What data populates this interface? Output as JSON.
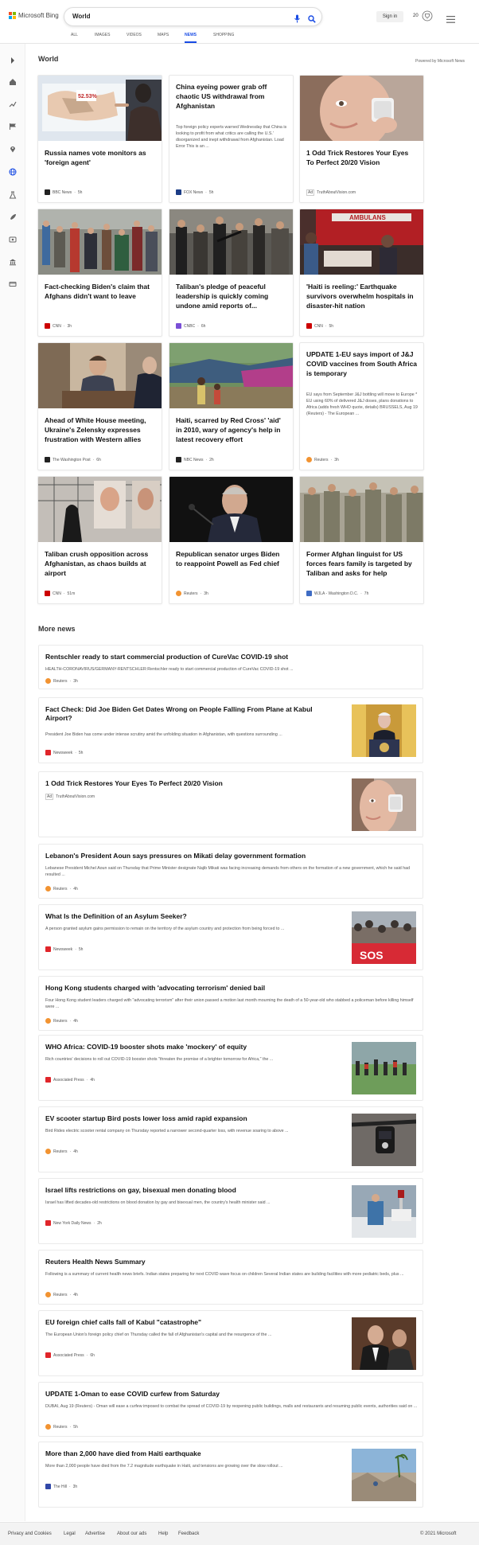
{
  "header": {
    "logo_text": "Microsoft Bing",
    "search_value": "World",
    "signin_label": "Sign in",
    "points": "20",
    "tabs": [
      "ALL",
      "IMAGES",
      "VIDEOS",
      "MAPS",
      "NEWS",
      "SHOPPING"
    ],
    "active_tab": "NEWS",
    "accent_color": "#174ae4"
  },
  "world": {
    "title": "World",
    "powered_by": "Powered by Microsoft News",
    "cards": [
      {
        "title": "Russia names vote monitors as 'foreign agent'",
        "source": "BBC News",
        "time": "5h",
        "source_color": "#222",
        "image": "map-screen-photo"
      },
      {
        "title": "China eyeing power grab off chaotic US withdrawal from Afghanistan",
        "snippet": "Top foreign policy experts warned Wednesday that China is looking to profit from what critics are calling the U.S.' disorganized and inept withdrawal from Afghanistan. Load Error This is an ...",
        "source": "FOX News",
        "time": "5h",
        "source_color": "#1c3d86"
      },
      {
        "title": "1 Odd Trick Restores Your Eyes To Perfect 20/20 Vision",
        "ad": "Ad",
        "source": "TruthAboutVision.com",
        "time": "",
        "image": "eye-ad-photo"
      },
      {
        "title": "Fact-checking Biden's claim that Afghans didn't want to leave",
        "source": "CNN",
        "time": "3h",
        "source_color": "#cc0000",
        "image": "crowd-photo"
      },
      {
        "title": "Taliban's pledge of peaceful leadership is quickly coming undone amid reports of...",
        "source": "CNBC",
        "time": "6h",
        "source_color": "#7a4fd6",
        "image": "taliban-photo"
      },
      {
        "title": "'Haiti is reeling:' Earthquake survivors overwhelm hospitals in disaster-hit nation",
        "source": "CNN",
        "time": "5h",
        "source_color": "#cc0000",
        "image": "ambulance-photo"
      },
      {
        "title": "Ahead of White House meeting, Ukraine's Zelensky expresses frustration with Western allies",
        "source": "The Washington Post",
        "time": "6h",
        "source_color": "#222",
        "image": "zelensky-photo"
      },
      {
        "title": "Haiti, scarred by Red Cross' 'aid' in 2010, wary of agency's help in latest recovery effort",
        "source": "NBC News",
        "time": "2h",
        "source_color": "#222",
        "image": "haiti-camp-photo"
      },
      {
        "title": "UPDATE 1-EU says import of J&J COVID vaccines from South Africa is temporary",
        "snippet": "EU says from September J&J bottling will move to Europe * EU using 60% of delivered J&J doses, plans donations to Africa (adds fresh WHO quote, details) BRUSSELS, Aug 19 (Reuters) - The European ...",
        "source": "Reuters",
        "time": "3h",
        "source_color": "#f29331"
      },
      {
        "title": "Taliban crush opposition across Afghanistan, as chaos builds at airport",
        "source": "CNN",
        "time": "51m",
        "source_color": "#cc0000",
        "image": "wall-poster-photo"
      },
      {
        "title": "Republican senator urges Biden to reappoint Powell as Fed chief",
        "source": "Reuters",
        "time": "3h",
        "source_color": "#f29331",
        "image": "powell-photo"
      },
      {
        "title": "Former Afghan linguist for US forces fears family is targeted by Taliban and asks for help",
        "source": "WJLA - Washington D.C.",
        "time": "7h",
        "source_color": "#3f6cc4",
        "image": "soldiers-photo"
      }
    ]
  },
  "more_news": {
    "title": "More news",
    "items": [
      {
        "title": "Rentschler ready to start commercial production of CureVac COVID-19 shot",
        "snippet": "HEALTH-CORONAVIRUS/GERMANY-RENTSCHLER:Rentschler ready to start commercial production of CureVac COVID-19 shot ...",
        "source": "Reuters",
        "time": "3h",
        "source_color": "#f29331"
      },
      {
        "title": "Fact Check: Did Joe Biden Get Dates Wrong on People Falling From Plane at Kabul Airport?",
        "snippet": "President Joe Biden has come under intense scrutiny amid the unfolding situation in Afghanistan, with questions surrounding ...",
        "source": "Newsweek",
        "time": "5h",
        "source_color": "#e0252a",
        "image": "biden-photo"
      },
      {
        "title": "1 Odd Trick Restores Your Eyes To Perfect 20/20 Vision",
        "ad": "Ad",
        "source": "TruthAboutVision.com",
        "time": "",
        "image": "eye-ad-photo"
      },
      {
        "title": "Lebanon's President Aoun says pressures on Mikati delay government formation",
        "snippet": "Lebanese President Michel Aoun said on Thursday that Prime Minister designate Najib Mikati was facing increasing demands from others on the formation of a new government, which he said had resulted ...",
        "source": "Reuters",
        "time": "4h",
        "source_color": "#f29331"
      },
      {
        "title": "What Is the Definition of an Asylum Seeker?",
        "snippet": "A person granted asylum gains permission to remain on the territory of the asylum country and protection from being forced to ...",
        "source": "Newsweek",
        "time": "5h",
        "source_color": "#e0252a",
        "image": "protest-photo"
      },
      {
        "title": "Hong Kong students charged with 'advocating terrorism' denied bail",
        "snippet": "Four Hong Kong student leaders charged with \"advocating terrorism\" after their union passed a motion last month mourning the death of a 50-year-old who stabbed a policeman before killing himself were ...",
        "source": "Reuters",
        "time": "4h",
        "source_color": "#f29331"
      },
      {
        "title": "WHO Africa: COVID-19 booster shots make 'mockery' of equity",
        "snippet": "Rich countries' decisions to roll out COVID-19 booster shots \"threaten the promise of a brighter tomorrow for Africa,\" the ...",
        "source": "Associated Press",
        "time": "4h",
        "source_color": "#e0252a",
        "image": "who-photo"
      },
      {
        "title": "EV scooter startup Bird posts lower loss amid rapid expansion",
        "snippet": "Bird Rides electric scooter rental company on Thursday reported a narrower second-quarter loss, with revenue soaring to above ...",
        "source": "Reuters",
        "time": "4h",
        "source_color": "#f29331",
        "image": "scooter-photo"
      },
      {
        "title": "Israel lifts restrictions on gay, bisexual men donating blood",
        "snippet": "Israel has lifted decades-old restrictions on blood donation by gay and bisexual men, the country's health minister said ...",
        "source": "New York Daily News",
        "time": "2h",
        "source_color": "#e0252a",
        "image": "blood-photo"
      },
      {
        "title": "Reuters Health News Summary",
        "snippet": "Following is a summary of current health news briefs. Indian states preparing for next COVID wave focus on children Several Indian states are building facilities with more pediatric beds, plus ...",
        "source": "Reuters",
        "time": "4h",
        "source_color": "#f29331"
      },
      {
        "title": "EU foreign chief calls fall of Kabul \"catastrophe\"",
        "snippet": "The European Union's foreign policy chief on Thursday called the fall of Afghanistan's capital and the resurgence of the ...",
        "source": "Associated Press",
        "time": "6h",
        "source_color": "#e0252a",
        "image": "ghani-photo"
      },
      {
        "title": "UPDATE 1-Oman to ease COVID curfew from Saturday",
        "snippet": "DUBAI, Aug 19 (Reuters) - Oman will ease a curfew imposed to combat the spread of COVID-19 by reopening public buildings, malls and restaurants and resuming public events, authorities said on ...",
        "source": "Reuters",
        "time": "5h",
        "source_color": "#f29331"
      },
      {
        "title": "More than 2,000 have died from Haiti earthquake",
        "snippet": "More than 2,000 people have died from the 7.2 magnitude earthquake in Haiti, and tensions are growing over the slow rollout ...",
        "source": "The Hill",
        "time": "3h",
        "source_color": "#3148a8",
        "image": "rubble-photo"
      }
    ]
  },
  "footer": {
    "links": [
      "Privacy and Cookies",
      "Legal",
      "Advertise",
      "About our ads",
      "Help",
      "Feedback"
    ],
    "copyright": "© 2021 Microsoft"
  }
}
